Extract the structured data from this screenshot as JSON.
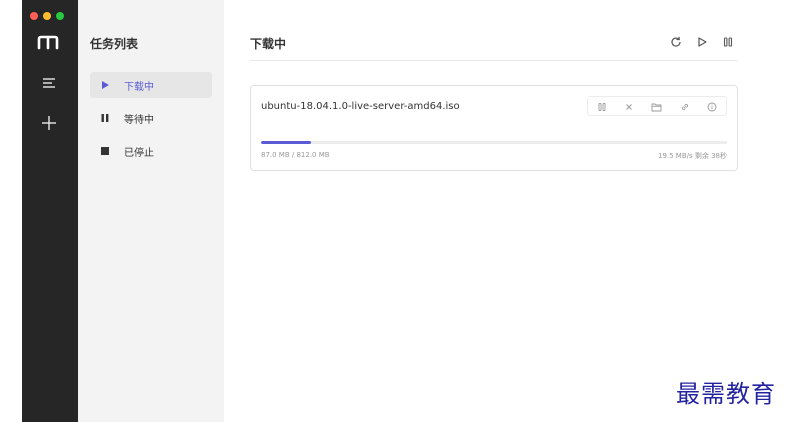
{
  "app": {
    "name": "Motrix",
    "accent_color": "#5b5bd6"
  },
  "rail": {
    "logo_icon": "motrix-logo-icon",
    "items": [
      {
        "icon": "menu-list-icon"
      },
      {
        "icon": "plus-icon"
      }
    ]
  },
  "tasks_panel": {
    "title": "任务列表",
    "items": [
      {
        "label": "下载中",
        "icon": "play-icon",
        "active": true
      },
      {
        "label": "等待中",
        "icon": "pause-icon",
        "active": false
      },
      {
        "label": "已停止",
        "icon": "stop-icon",
        "active": false
      }
    ]
  },
  "main": {
    "title": "下载中",
    "actions": [
      {
        "icon": "refresh-icon"
      },
      {
        "icon": "play-icon"
      },
      {
        "icon": "pause-icon"
      }
    ]
  },
  "download": {
    "file_name": "ubuntu-18.04.1.0-live-server-amd64.iso",
    "size_text": "87.0 MB / 812.0 MB",
    "speed_text": "19.5 MB/s 剩余 38秒",
    "progress": 0.107,
    "ops": [
      {
        "icon": "pause-icon"
      },
      {
        "icon": "close-icon"
      },
      {
        "icon": "folder-icon"
      },
      {
        "icon": "link-icon"
      },
      {
        "icon": "info-icon"
      }
    ]
  },
  "watermark": "最需教育"
}
